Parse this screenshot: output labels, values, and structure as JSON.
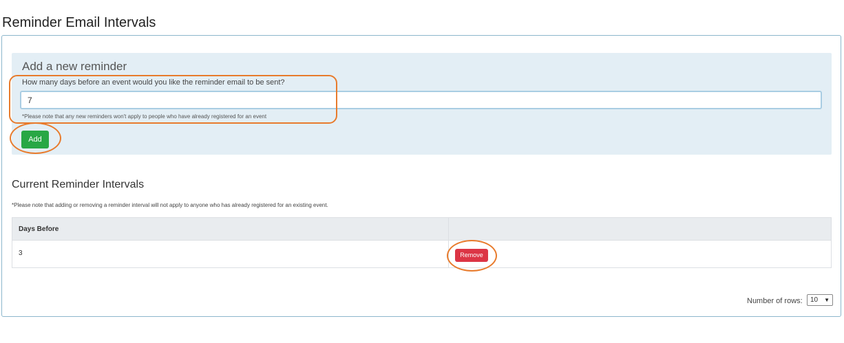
{
  "page": {
    "title": "Reminder Email Intervals"
  },
  "add_reminder": {
    "title": "Add a new reminder",
    "question": "How many days before an event would you like the reminder email to be sent?",
    "input_value": "7",
    "note": "*Please note that any new reminders won't apply to people who have already registered for an event",
    "add_label": "Add"
  },
  "current": {
    "title": "Current Reminder Intervals",
    "note": "*Please note that adding or removing a reminder interval will not apply to anyone who has already registered for an existing event.",
    "columns": [
      "Days Before",
      ""
    ],
    "rows": [
      {
        "days_before": "3",
        "action_label": "Remove"
      }
    ]
  },
  "pagination": {
    "rows_label": "Number of rows:",
    "rows_value": "10"
  },
  "colors": {
    "add_button": "#28a745",
    "remove_button": "#dc3545",
    "highlight": "#e87b2c",
    "add_box_bg": "#e3eef5"
  }
}
